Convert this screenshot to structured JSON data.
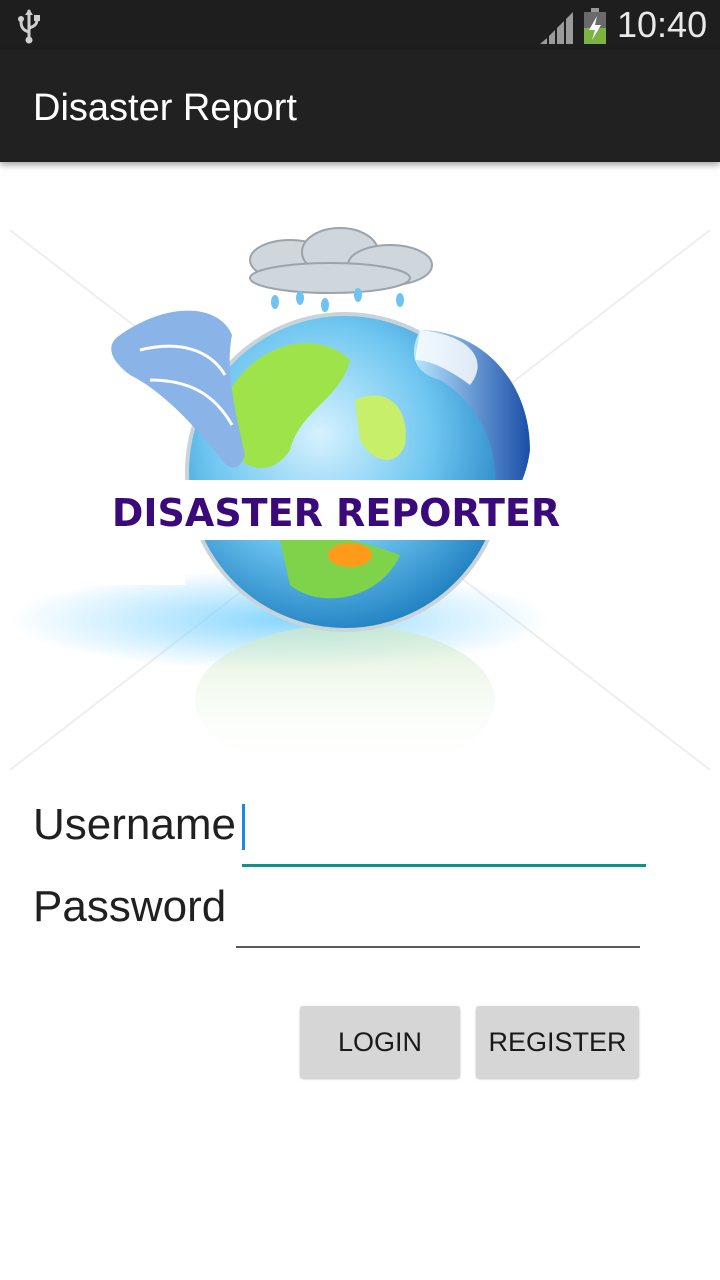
{
  "status_bar": {
    "time": "10:40",
    "icons": [
      "usb-icon",
      "signal-icon",
      "battery-charging-icon"
    ]
  },
  "app_bar": {
    "title": "Disaster Report"
  },
  "logo": {
    "text": "DISASTER REPORTER"
  },
  "form": {
    "username_label": "Username",
    "username_value": "",
    "password_label": "Password",
    "password_value": ""
  },
  "buttons": {
    "login": "LOGIN",
    "register": "REGISTER"
  },
  "colors": {
    "accent": "#0d9488",
    "caret": "#1e88e5",
    "app_bar": "#212121",
    "logo_text": "#3b0a7a"
  }
}
